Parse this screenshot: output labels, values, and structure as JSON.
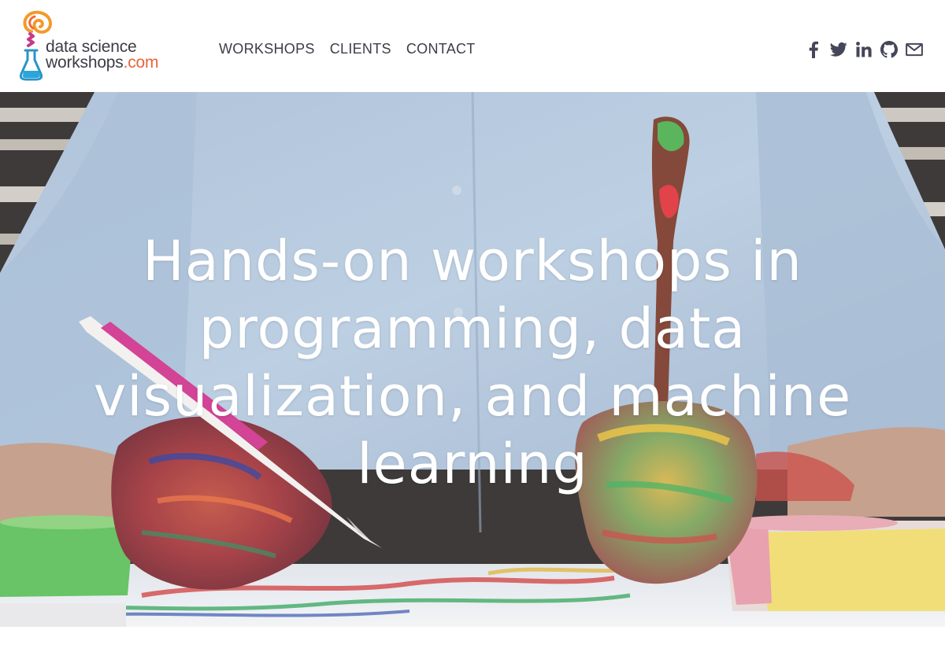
{
  "logo": {
    "line1": "data science",
    "line2_main": "workshops",
    "line2_suffix": ".com",
    "colors": {
      "text": "#3c3c46",
      "accent": "#e8643a"
    }
  },
  "nav": {
    "items": [
      {
        "label": "WORKSHOPS"
      },
      {
        "label": "CLIENTS"
      },
      {
        "label": "CONTACT"
      }
    ]
  },
  "social": {
    "icons": [
      "facebook-icon",
      "twitter-icon",
      "linkedin-icon",
      "github-icon",
      "email-icon"
    ],
    "color": "#45465a"
  },
  "hero": {
    "title": "Hands-on workshops in programming, data visualization, and machine learning"
  }
}
